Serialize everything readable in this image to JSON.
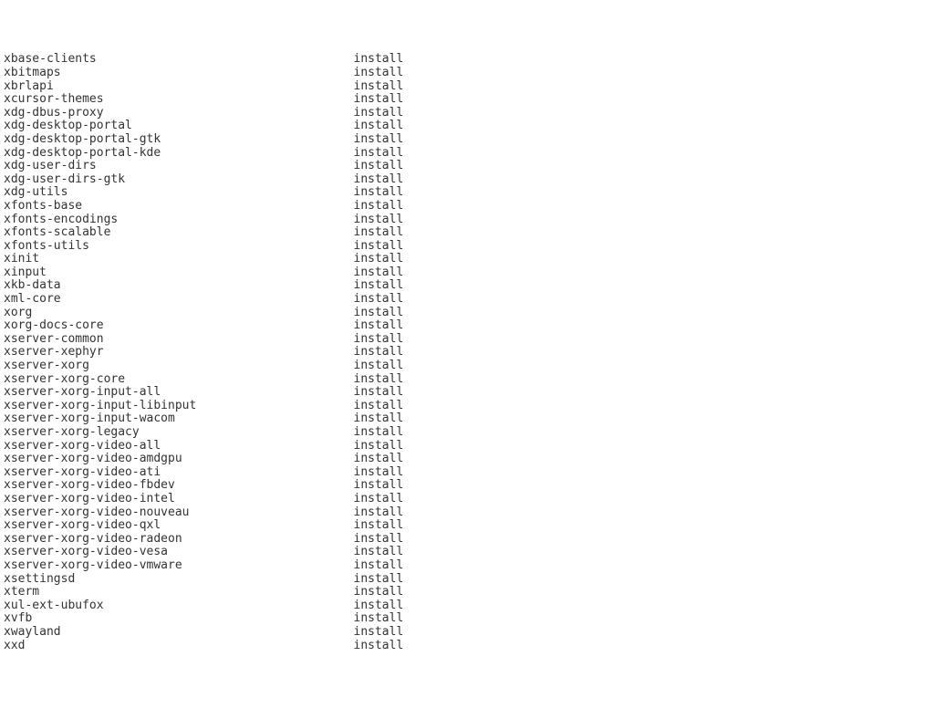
{
  "packages": [
    {
      "name": "xbase-clients",
      "status": "install"
    },
    {
      "name": "xbitmaps",
      "status": "install"
    },
    {
      "name": "xbrlapi",
      "status": "install"
    },
    {
      "name": "xcursor-themes",
      "status": "install"
    },
    {
      "name": "xdg-dbus-proxy",
      "status": "install"
    },
    {
      "name": "xdg-desktop-portal",
      "status": "install"
    },
    {
      "name": "xdg-desktop-portal-gtk",
      "status": "install"
    },
    {
      "name": "xdg-desktop-portal-kde",
      "status": "install"
    },
    {
      "name": "xdg-user-dirs",
      "status": "install"
    },
    {
      "name": "xdg-user-dirs-gtk",
      "status": "install"
    },
    {
      "name": "xdg-utils",
      "status": "install"
    },
    {
      "name": "xfonts-base",
      "status": "install"
    },
    {
      "name": "xfonts-encodings",
      "status": "install"
    },
    {
      "name": "xfonts-scalable",
      "status": "install"
    },
    {
      "name": "xfonts-utils",
      "status": "install"
    },
    {
      "name": "xinit",
      "status": "install"
    },
    {
      "name": "xinput",
      "status": "install"
    },
    {
      "name": "xkb-data",
      "status": "install"
    },
    {
      "name": "xml-core",
      "status": "install"
    },
    {
      "name": "xorg",
      "status": "install"
    },
    {
      "name": "xorg-docs-core",
      "status": "install"
    },
    {
      "name": "xserver-common",
      "status": "install"
    },
    {
      "name": "xserver-xephyr",
      "status": "install"
    },
    {
      "name": "xserver-xorg",
      "status": "install"
    },
    {
      "name": "xserver-xorg-core",
      "status": "install"
    },
    {
      "name": "xserver-xorg-input-all",
      "status": "install"
    },
    {
      "name": "xserver-xorg-input-libinput",
      "status": "install"
    },
    {
      "name": "xserver-xorg-input-wacom",
      "status": "install"
    },
    {
      "name": "xserver-xorg-legacy",
      "status": "install"
    },
    {
      "name": "xserver-xorg-video-all",
      "status": "install"
    },
    {
      "name": "xserver-xorg-video-amdgpu",
      "status": "install"
    },
    {
      "name": "xserver-xorg-video-ati",
      "status": "install"
    },
    {
      "name": "xserver-xorg-video-fbdev",
      "status": "install"
    },
    {
      "name": "xserver-xorg-video-intel",
      "status": "install"
    },
    {
      "name": "xserver-xorg-video-nouveau",
      "status": "install"
    },
    {
      "name": "xserver-xorg-video-qxl",
      "status": "install"
    },
    {
      "name": "xserver-xorg-video-radeon",
      "status": "install"
    },
    {
      "name": "xserver-xorg-video-vesa",
      "status": "install"
    },
    {
      "name": "xserver-xorg-video-vmware",
      "status": "install"
    },
    {
      "name": "xsettingsd",
      "status": "install"
    },
    {
      "name": "xterm",
      "status": "install"
    },
    {
      "name": "xul-ext-ubufox",
      "status": "install"
    },
    {
      "name": "xvfb",
      "status": "install"
    },
    {
      "name": "xwayland",
      "status": "install"
    },
    {
      "name": "xxd",
      "status": "install"
    }
  ]
}
